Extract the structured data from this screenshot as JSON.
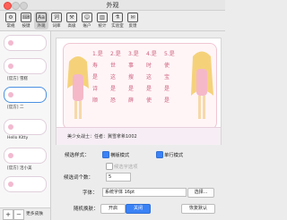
{
  "window": {
    "title": "外观"
  },
  "toolbar": [
    {
      "label": "常规",
      "icon": "gear-icon",
      "glyph": "⚙"
    },
    {
      "label": "按键",
      "icon": "keyboard-icon",
      "glyph": "⌨"
    },
    {
      "label": "外观",
      "icon": "appearance-icon",
      "glyph": "Aa"
    },
    {
      "label": "词库",
      "icon": "dictionary-icon",
      "glyph": "词"
    },
    {
      "label": "高级",
      "icon": "advanced-icon",
      "glyph": "⚒"
    },
    {
      "label": "账户",
      "icon": "account-icon",
      "glyph": "☺"
    },
    {
      "label": "统计",
      "icon": "stats-icon",
      "glyph": "▥"
    },
    {
      "label": "实验室",
      "icon": "lab-icon",
      "glyph": "⚗"
    },
    {
      "label": "反馈",
      "icon": "feedback-icon",
      "glyph": "✉"
    }
  ],
  "sidebar": {
    "skins": [
      {
        "name": "[官方] 雪糕"
      },
      {
        "name": "[官方] 二"
      },
      {
        "name": "Hello Kitty"
      },
      {
        "name": "[官方] 活小美"
      }
    ],
    "add_label": "+",
    "remove_label": "−",
    "more_label": "更多皮肤"
  },
  "preview": {
    "row1": [
      "1.是",
      "2.是",
      "3.是",
      "4.是",
      "5.是"
    ],
    "row2": [
      "寿",
      "世",
      "事",
      "时",
      "使"
    ],
    "row3": [
      "是",
      "这",
      "搜",
      "这",
      "宝"
    ],
    "row4": [
      "诗",
      "是",
      "是",
      "是",
      "是"
    ],
    "row5": [
      "顺",
      "恐",
      "薛",
      "使",
      "是"
    ],
    "status": "美少女战士：任者：冀雪拿希1002"
  },
  "options": {
    "candidate_style_label": "候选样式：",
    "horizontal_label": "横版模式",
    "single_row_label": "单行模式",
    "vertical_label": "候选字选项",
    "candidate_count_label": "候选词个数：",
    "candidate_count_value": "5",
    "font_label": "字体：",
    "font_value": "系统字体 16pt",
    "font_button": "选择...",
    "random_skin_label": "随机换肤：",
    "random_on": "开启",
    "random_off": "关闭",
    "restore_button": "恢复默认"
  },
  "colors": {
    "accent": "#3b82f6",
    "pink": "#f0c6d2"
  }
}
